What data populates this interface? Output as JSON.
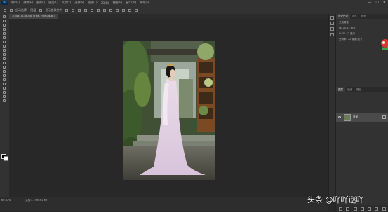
{
  "app": {
    "logo": "Ps",
    "menu": [
      "文件(F)",
      "编辑(E)",
      "图像(I)",
      "图层(L)",
      "文字(Y)",
      "选择(S)",
      "滤镜(T)",
      "3D(D)",
      "视图(V)",
      "窗口(W)",
      "帮助(H)"
    ],
    "window_controls": [
      "—",
      "☐",
      "✕"
    ]
  },
  "options": {
    "auto_select_label": "自动选择:",
    "layer_label": "图层",
    "transform_label": "显示变换控件"
  },
  "document": {
    "tab_title": "1(hua1313dl.jpg @ 66.7%(RGB/8))",
    "zoom": "66.67%",
    "doc_info": "文档:3.19M/3.19M"
  },
  "panels": {
    "top_tabs": [
      "历史记录",
      "属性",
      "颜色"
    ],
    "properties_title": "文档属性",
    "size_row": "W: 20.14 厘米",
    "height_row": "H: 30.22 厘米",
    "resolution_row": "分辨率: 72 像素/英寸",
    "layer_tabs": [
      "图层",
      "通道",
      "路径"
    ],
    "layer_name": "背景"
  },
  "watermark": "头条 @吖吖谜吖",
  "colors": {
    "accent": "#31a8ff",
    "workspace": "#282828",
    "panel": "#323232"
  }
}
